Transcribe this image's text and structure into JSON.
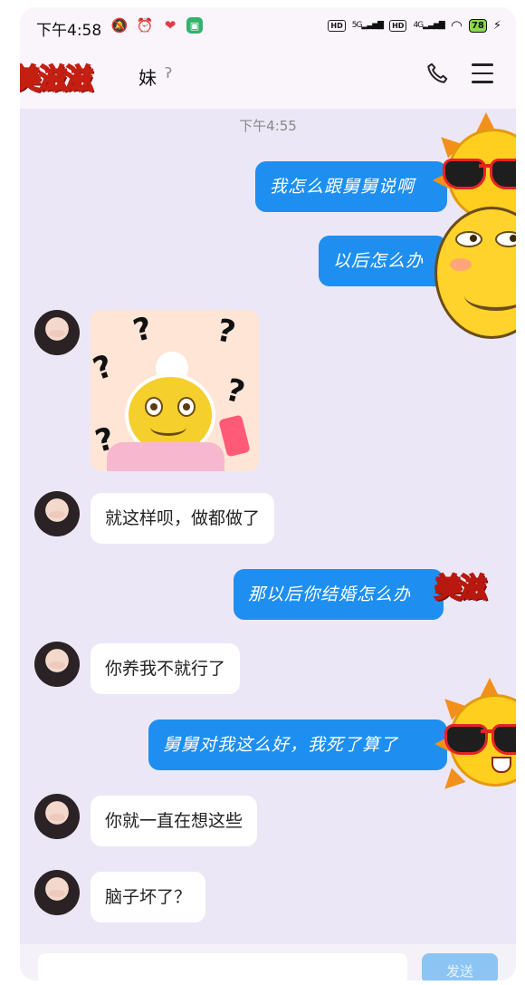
{
  "status": {
    "time": "下午4:58",
    "icons": [
      "mute-icon",
      "alarm-icon",
      "heart-app-icon",
      "app-icon"
    ],
    "hd1": "HD",
    "net1": "5G",
    "hd2": "HD",
    "net2": "4G",
    "battery": "78"
  },
  "header": {
    "name_sticker": "美滋滋",
    "contact_name": "妹",
    "ear_icon": "ear-icon",
    "call_icon": "phone-icon",
    "menu_icon": "menu-icon"
  },
  "chat": {
    "timestamp": "下午4:55",
    "messages": [
      {
        "side": "out",
        "text": "我怎么跟舅舅说啊"
      },
      {
        "side": "out",
        "text": "以后怎么办"
      },
      {
        "side": "in",
        "type": "sticker",
        "text": "?"
      },
      {
        "side": "in",
        "text": "就这样呗，做都做了"
      },
      {
        "side": "out",
        "text": "那以后你结婚怎么办"
      },
      {
        "side": "in",
        "text": "你养我不就行了"
      },
      {
        "side": "out",
        "text": "舅舅对我这么好，我死了算了"
      },
      {
        "side": "in",
        "text": "你就一直在想这些"
      },
      {
        "side": "in",
        "text": "脑子坏了？"
      }
    ],
    "overlay_stickers": [
      "美滋"
    ]
  },
  "input": {
    "placeholder": "",
    "send_label": "发送"
  },
  "colors": {
    "outgoing_bubble": "#1e8ff0",
    "incoming_bubble": "#ffffff",
    "background": "#ece7f6"
  }
}
